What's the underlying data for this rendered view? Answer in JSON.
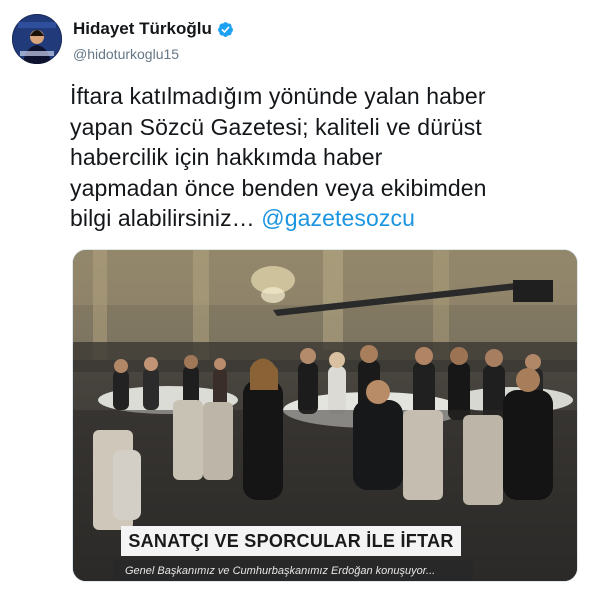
{
  "user": {
    "display_name": "Hidayet Türkoğlu",
    "handle": "@hidoturkoglu15",
    "verified": true,
    "avatar_icon": "profile-photo"
  },
  "tweet": {
    "text_lines": [
      "İftara katılmadığım yönünde yalan haber",
      "yapan Sözcü Gazetesi; kaliteli ve dürüst",
      "habercilik için hakkımda haber",
      "yapmadan önce benden veya ekibimden",
      "bilgi alabilirsiniz… "
    ],
    "mention": "@gazetesozcu"
  },
  "media": {
    "caption": "SANATÇI VE SPORCULAR İLE İFTAR",
    "subtitle": "Genel Başkanımız ve  Cumhurbaşkanımız Erdoğan konuşuyor..."
  },
  "colors": {
    "link": "#1b95e0",
    "verified_badge": "#1da1f2",
    "secondary_text": "#657786"
  }
}
